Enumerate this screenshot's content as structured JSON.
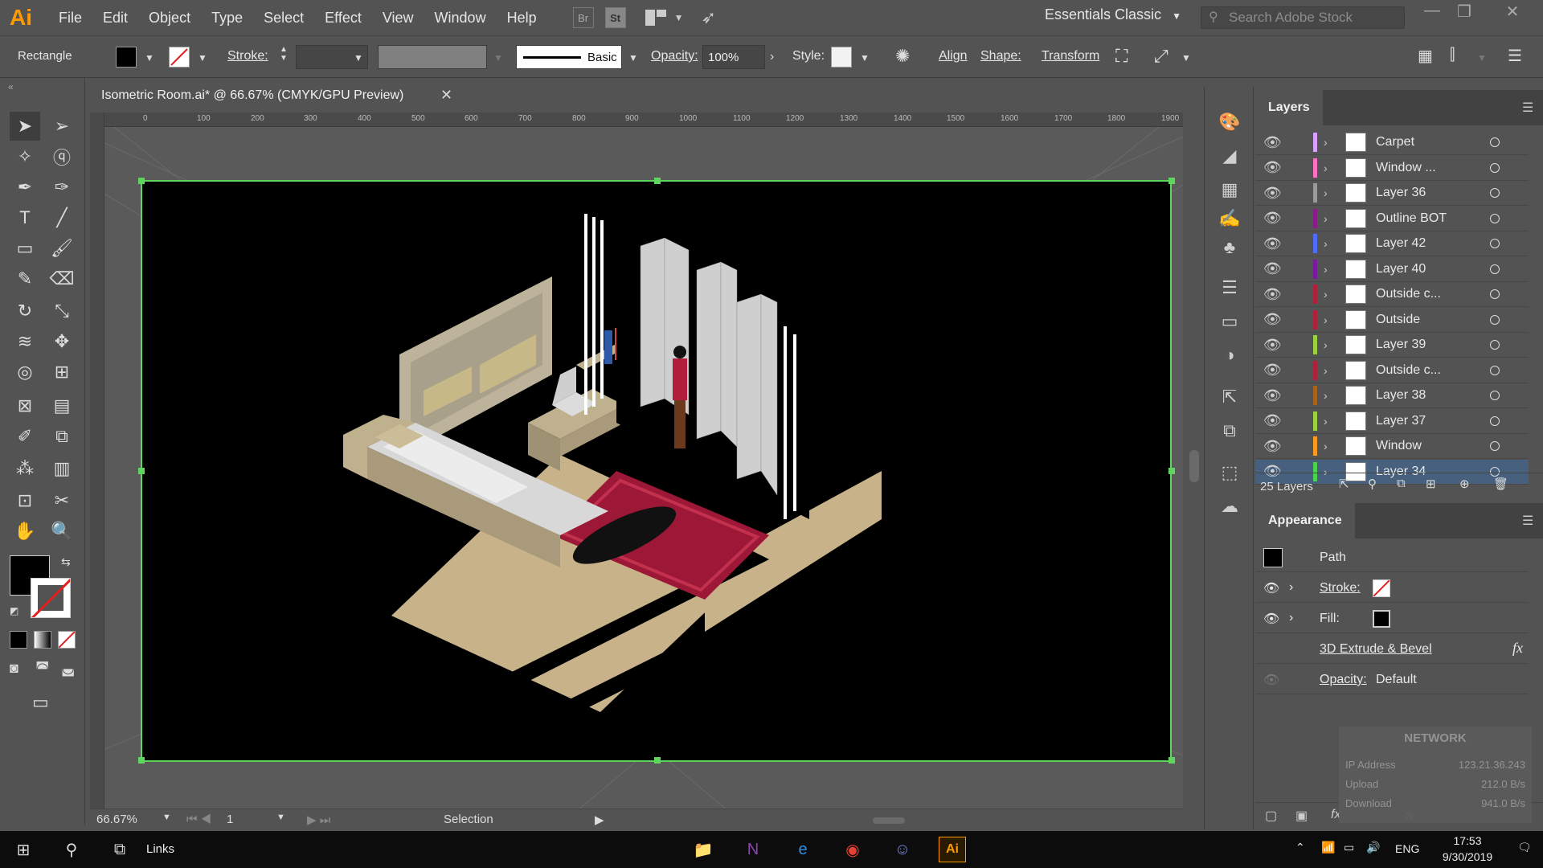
{
  "app": {
    "logo": "Ai",
    "menu": [
      "File",
      "Edit",
      "Object",
      "Type",
      "Select",
      "Effect",
      "View",
      "Window",
      "Help"
    ],
    "bridge_label": "Br",
    "stock_label": "St",
    "workspace": "Essentials Classic",
    "search_placeholder": "Search Adobe Stock"
  },
  "control_bar": {
    "tool_name": "Rectangle",
    "stroke_label": "Stroke:",
    "brush_label": "Basic",
    "opacity_label": "Opacity:",
    "opacity_value": "100%",
    "style_label": "Style:",
    "align_label": "Align",
    "shape_label": "Shape:",
    "transform_label": "Transform"
  },
  "document": {
    "tab_title": "Isometric Room.ai* @ 66.67% (CMYK/GPU Preview)",
    "ruler_ticks": [
      "0",
      "100",
      "200",
      "300",
      "400",
      "500",
      "600",
      "700",
      "800",
      "900",
      "1000",
      "1100",
      "1200",
      "1300",
      "1400",
      "1500",
      "1600",
      "1700",
      "1800",
      "1900"
    ],
    "zoom": "66.67%",
    "artboard_num": "1",
    "status_mode": "Selection"
  },
  "layers_panel": {
    "title": "Layers",
    "layers": [
      {
        "name": "Carpet",
        "color": "#d8a1ff"
      },
      {
        "name": "Window ...",
        "color": "#ff6fc4"
      },
      {
        "name": "Layer 36",
        "color": "#9a9a9a"
      },
      {
        "name": "Outline BOT",
        "color": "#8a1c8a"
      },
      {
        "name": "Layer 42",
        "color": "#4f6cff"
      },
      {
        "name": "Layer 40",
        "color": "#7a1aa0"
      },
      {
        "name": "Outside c...",
        "color": "#b0203c"
      },
      {
        "name": "Outside",
        "color": "#b0203c"
      },
      {
        "name": "Layer 39",
        "color": "#9ad23c"
      },
      {
        "name": "Outside c...",
        "color": "#b0203c"
      },
      {
        "name": "Layer 38",
        "color": "#a8641e"
      },
      {
        "name": "Layer 37",
        "color": "#9ad23c"
      },
      {
        "name": "Window",
        "color": "#ff9a1e"
      },
      {
        "name": "Layer 34",
        "color": "#4cd24c"
      }
    ],
    "count": "25 Layers"
  },
  "appearance_panel": {
    "title": "Appearance",
    "object_type": "Path",
    "stroke_label": "Stroke:",
    "fill_label": "Fill:",
    "effect_label": "3D Extrude & Bevel",
    "opacity_label": "Opacity:",
    "opacity_value": "Default",
    "fx_label": "fx"
  },
  "network": {
    "title": "NETWORK",
    "ip_label": "IP Address",
    "ip_value": "123.21.36.243",
    "upload_label": "Upload",
    "upload_value": "212.0 B/s",
    "download_label": "Download",
    "download_value": "941.0 B/s"
  },
  "taskbar": {
    "links_label": "Links",
    "lang": "ENG",
    "time": "17:53",
    "date": "9/30/2019"
  }
}
